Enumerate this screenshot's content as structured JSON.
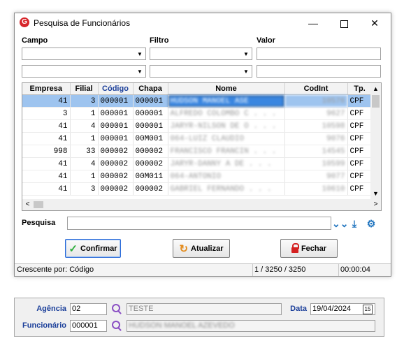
{
  "window": {
    "title": "Pesquisa de Funcionários",
    "controls": {
      "minimize": "—",
      "maximize": "",
      "close": "✕"
    }
  },
  "filters": {
    "campo_label": "Campo",
    "filtro_label": "Filtro",
    "valor_label": "Valor",
    "rows": [
      {
        "campo": "",
        "filtro": "",
        "valor": ""
      },
      {
        "campo": "",
        "filtro": "",
        "valor": ""
      }
    ]
  },
  "grid": {
    "columns": [
      "Empresa",
      "Filial",
      "Código",
      "Chapa",
      "Nome",
      "CodInt",
      "Tp."
    ],
    "sorted_column": "Código",
    "rows": [
      {
        "empresa": "41",
        "filial": "3",
        "codigo": "000001",
        "chapa": "000001",
        "nome": "HUDSON MANOEL ASE",
        "codint": "10576",
        "tp": "CPF"
      },
      {
        "empresa": "3",
        "filial": "1",
        "codigo": "000001",
        "chapa": "000001",
        "nome": "ALFREDO COLOMBO C . . .",
        "codint": "9627",
        "tp": "CPF"
      },
      {
        "empresa": "41",
        "filial": "4",
        "codigo": "000001",
        "chapa": "000001",
        "nome": "JARYR-NILSON DE O . . .",
        "codint": "10598",
        "tp": "CPF"
      },
      {
        "empresa": "41",
        "filial": "1",
        "codigo": "000001",
        "chapa": "00M001",
        "nome": "064-LUIZ CLAUDIO",
        "codint": "9076",
        "tp": "CPF"
      },
      {
        "empresa": "998",
        "filial": "33",
        "codigo": "000002",
        "chapa": "000002",
        "nome": "FRANCISCO FRANCIN . . .",
        "codint": "14545",
        "tp": "CPF"
      },
      {
        "empresa": "41",
        "filial": "4",
        "codigo": "000002",
        "chapa": "000002",
        "nome": "JARYR-DANNY A  DE . . .",
        "codint": "10599",
        "tp": "CPF"
      },
      {
        "empresa": "41",
        "filial": "1",
        "codigo": "000002",
        "chapa": "00M011",
        "nome": "064-ANTONIO",
        "codint": "9077",
        "tp": "CPF"
      },
      {
        "empresa": "41",
        "filial": "3",
        "codigo": "000002",
        "chapa": "000002",
        "nome": "GABRIEL FERNANDO . . .",
        "codint": "10610",
        "tp": "CPF"
      }
    ],
    "selected_index": 0
  },
  "search": {
    "label": "Pesquisa",
    "value": "",
    "icons": [
      "chevrons-down-icon",
      "download-arrow-icon",
      "gear-icon"
    ]
  },
  "buttons": {
    "confirm": "Confirmar",
    "refresh": "Atualizar",
    "close": "Fechar"
  },
  "status": {
    "sort": "Crescente por: Código",
    "count": "1 / 3250 / 3250",
    "time": "00:00:04"
  },
  "lower_panel": {
    "agencia_label": "Agência",
    "agencia_code": "02",
    "agencia_name": "TESTE",
    "data_label": "Data",
    "data_value": "19/04/2024",
    "funcionario_label": "Funcionário",
    "funcionario_code": "000001",
    "funcionario_name": "HUDSON MANOEL AZEVEDO"
  },
  "colors": {
    "selected_row": "#9ec4ef",
    "selected_cell": "#3a86e0",
    "label_blue": "#1b3f9a",
    "app_icon": "#d7262b"
  }
}
